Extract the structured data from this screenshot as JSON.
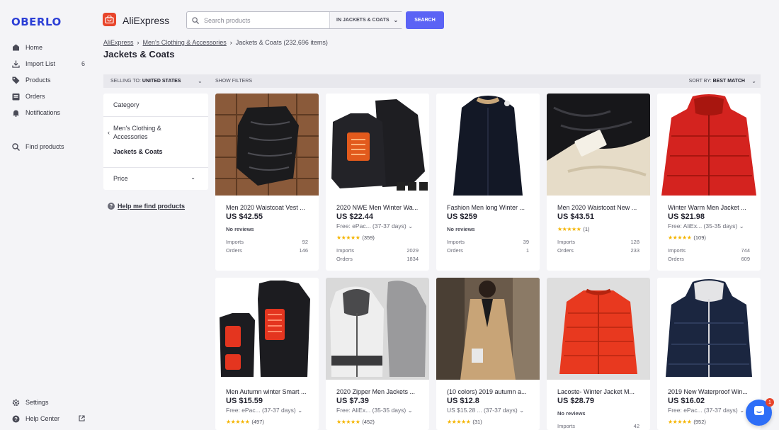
{
  "sidebar": {
    "logo": "OBERLO",
    "items": [
      {
        "label": "Home",
        "icon": "home-icon"
      },
      {
        "label": "Import List",
        "icon": "download-icon",
        "count": "6"
      },
      {
        "label": "Products",
        "icon": "tag-icon"
      },
      {
        "label": "Orders",
        "icon": "orders-icon"
      },
      {
        "label": "Notifications",
        "icon": "bell-icon"
      },
      {
        "label": "Find products",
        "icon": "search-icon"
      },
      {
        "label": "Settings",
        "icon": "gear-icon"
      },
      {
        "label": "Help Center",
        "icon": "question-icon"
      }
    ]
  },
  "header": {
    "brand": "AliExpress",
    "search_placeholder": "Search products",
    "scope": "IN JACKETS & COATS",
    "search_button": "SEARCH"
  },
  "breadcrumb": {
    "root": "AliExpress",
    "parent": "Men's Clothing & Accessories",
    "current": "Jackets & Coats (232,696 items)"
  },
  "page_title": "Jackets & Coats",
  "filter_bar": {
    "selling_label": "SELLING TO:",
    "selling_value": "UNITED STATES",
    "show_filters": "SHOW FILTERS",
    "sort_label": "SORT BY:",
    "sort_value": "BEST MATCH"
  },
  "category_panel": {
    "heading": "Category",
    "parent": "Men's Clothing & Accessories",
    "current": "Jackets & Coats",
    "price": "Price",
    "help": "Help me find products"
  },
  "labels": {
    "imports": "Imports",
    "orders": "Orders",
    "no_reviews": "No reviews"
  },
  "products": [
    {
      "title": "Men 2020 Waistcoat Vest ...",
      "price": "US $42.55",
      "ship": "",
      "reviews": null,
      "imports": "92",
      "orders": "146"
    },
    {
      "title": "2020 NWE Men Winter Wa...",
      "price": "US $22.44",
      "ship": "Free: ePac... (37-37 days)",
      "reviews": "(359)",
      "imports": "2029",
      "orders": "1834"
    },
    {
      "title": "Fashion Men long Winter ...",
      "price": "US $259",
      "ship": "",
      "reviews": null,
      "imports": "39",
      "orders": "1"
    },
    {
      "title": "Men 2020 Waistcoat New ...",
      "price": "US $43.51",
      "ship": "",
      "reviews": "(1)",
      "imports": "128",
      "orders": "233"
    },
    {
      "title": "Winter Warm Men Jacket ...",
      "price": "US $21.98",
      "ship": "Free: AliEx... (35-35 days)",
      "reviews": "(109)",
      "imports": "744",
      "orders": "609"
    },
    {
      "title": "Men Autumn winter Smart ...",
      "price": "US $15.59",
      "ship": "Free: ePac... (37-37 days)",
      "reviews": "(497)"
    },
    {
      "title": "2020 Zipper Men Jackets ...",
      "price": "US $7.39",
      "ship": "Free: AliEx... (35-35 days)",
      "reviews": "(452)"
    },
    {
      "title": "(10 colors) 2019 autumn a...",
      "price": "US $12.8",
      "ship": "US $15.28 ... (37-37 days)",
      "reviews": "(31)"
    },
    {
      "title": "Lacoste- Winter Jacket M...",
      "price": "US $28.79",
      "ship": "",
      "reviews": null,
      "imports": "42"
    },
    {
      "title": "2019 New Waterproof Win...",
      "price": "US $16.02",
      "ship": "Free: ePac... (37-37 days)",
      "reviews": "(952)"
    }
  ],
  "stars": "★★★★★",
  "chat_badge": "1",
  "colors": {
    "brand": "#2c3fd6",
    "accent": "#5b63f5",
    "star": "#f4b400",
    "aliexpress": "#e8452b"
  }
}
